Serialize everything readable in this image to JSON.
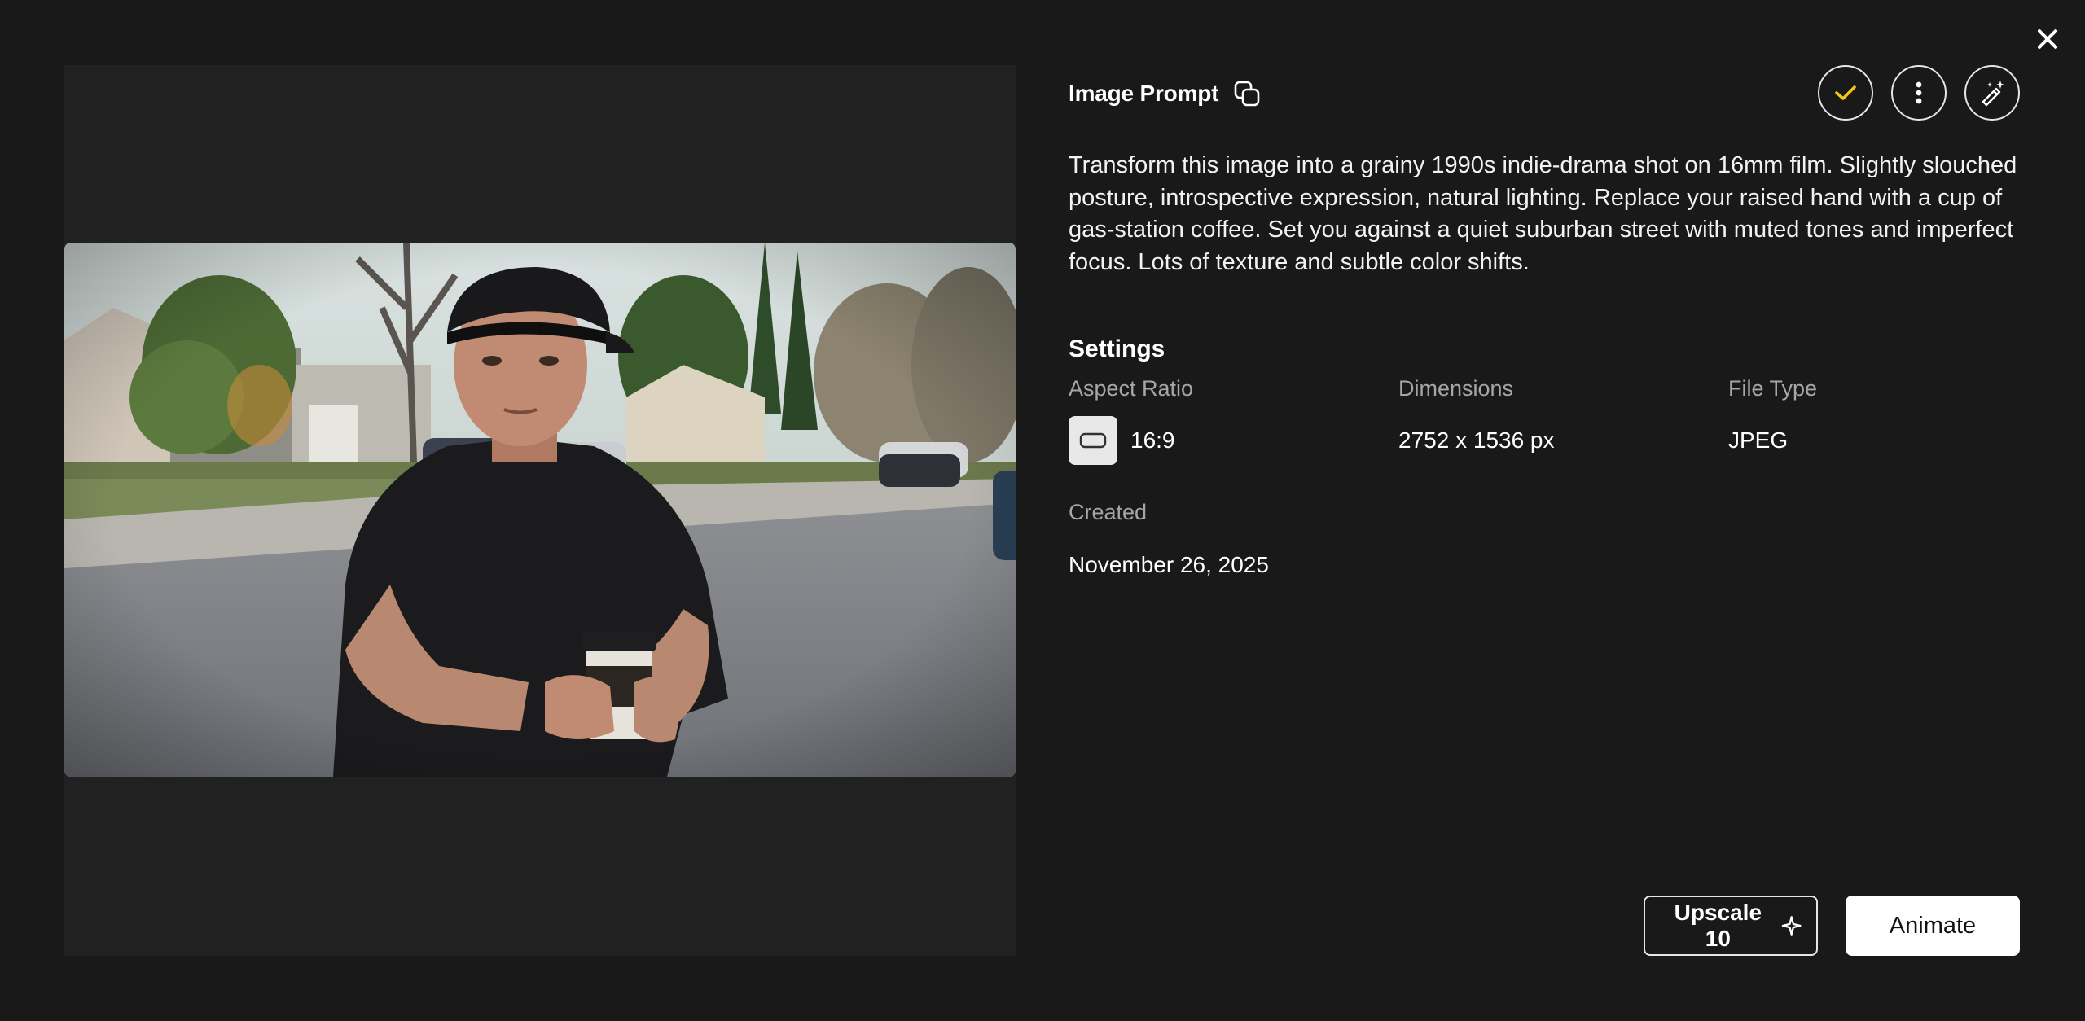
{
  "prompt": {
    "title": "Image Prompt",
    "text": "Transform this image into a grainy 1990s indie-drama shot on 16mm film. Slightly slouched posture, introspective expression, natural lighting. Replace your raised hand with a cup of gas-station coffee. Set you against a quiet suburban street with muted tones and imperfect focus. Lots of texture and subtle color shifts."
  },
  "settings": {
    "title": "Settings",
    "aspect_ratio_label": "Aspect Ratio",
    "aspect_ratio_value": "16:9",
    "dimensions_label": "Dimensions",
    "dimensions_value": "2752 x 1536 px",
    "file_type_label": "File Type",
    "file_type_value": "JPEG",
    "created_label": "Created",
    "created_value": "November 26, 2025"
  },
  "actions": {
    "upscale_label": "Upscale 10",
    "animate_label": "Animate"
  },
  "colors": {
    "background": "#191919",
    "panel": "#212121",
    "accent_check": "#f5c518"
  },
  "icons": [
    "close-icon",
    "copy-icon",
    "check-icon",
    "more-vertical-icon",
    "magic-wand-icon",
    "sparkle-icon",
    "aspect-ratio-icon"
  ]
}
